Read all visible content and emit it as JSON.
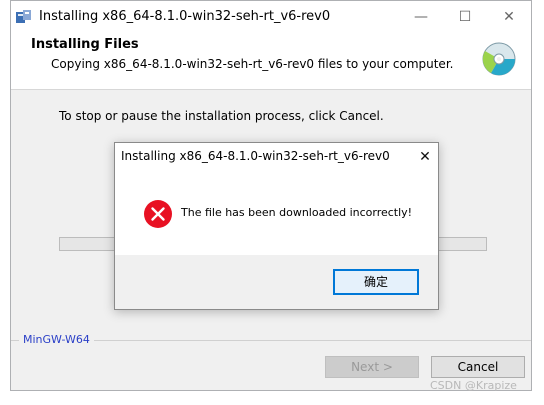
{
  "window": {
    "title": "Installing x86_64-8.1.0-win32-seh-rt_v6-rev0",
    "minimize": "—",
    "maximize": "☐",
    "close": "✕"
  },
  "header": {
    "title": "Installing Files",
    "subtitle": "Copying x86_64-8.1.0-win32-seh-rt_v6-rev0 files to your computer."
  },
  "main": {
    "instruction": "To stop or pause the installation process, click Cancel.",
    "brand": "MinGW-W64"
  },
  "buttons": {
    "next": "Next >",
    "cancel": "Cancel"
  },
  "dialog": {
    "title": "Installing x86_64-8.1.0-win32-seh-rt_v6-rev0",
    "close": "✕",
    "message": "The file has been downloaded incorrectly!",
    "ok": "确定"
  },
  "watermark": "CSDN @Krapize",
  "colors": {
    "error_red": "#e81123",
    "accent_blue": "#0078d7",
    "brand_blue": "#2a3fc7"
  }
}
